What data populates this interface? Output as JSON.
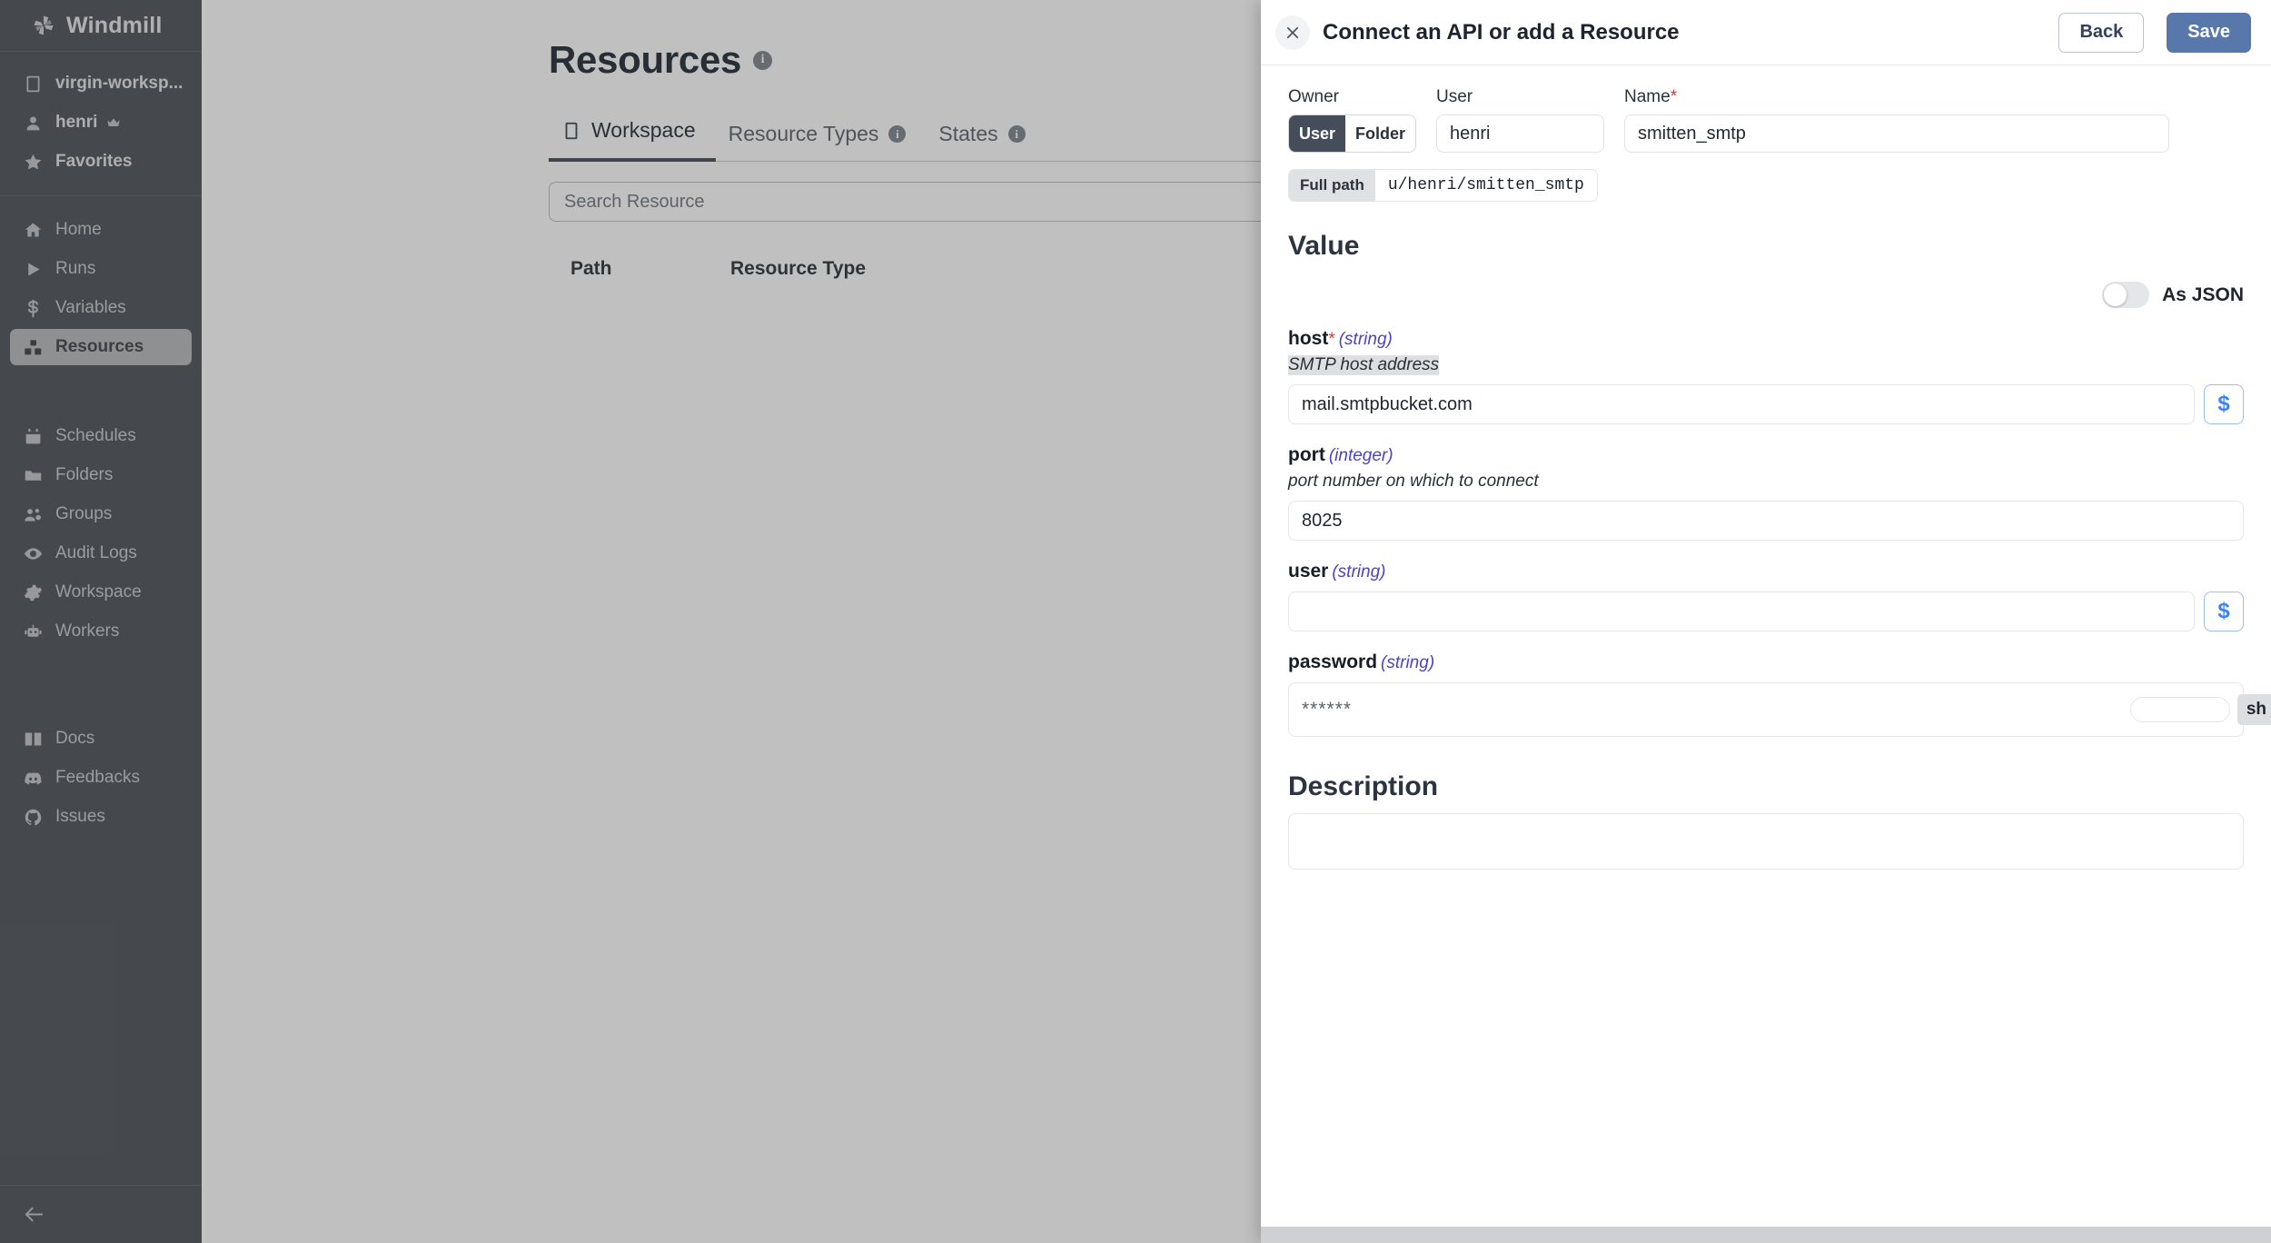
{
  "sidebar": {
    "brand": "Windmill",
    "top_items": [
      {
        "label": "virgin-worksp...",
        "icon": "building-icon",
        "name": "sidebar-item-workspace-switcher"
      },
      {
        "label": "henri",
        "icon": "user-icon",
        "name": "sidebar-item-user",
        "badge_icon": "crown-icon"
      },
      {
        "label": "Favorites",
        "icon": "star-icon",
        "name": "sidebar-item-favorites"
      }
    ],
    "main_items": [
      {
        "label": "Home",
        "icon": "home-icon",
        "name": "sidebar-item-home",
        "active": false
      },
      {
        "label": "Runs",
        "icon": "play-icon",
        "name": "sidebar-item-runs",
        "active": false
      },
      {
        "label": "Variables",
        "icon": "dollar-icon",
        "name": "sidebar-item-variables",
        "active": false
      },
      {
        "label": "Resources",
        "icon": "boxes-icon",
        "name": "sidebar-item-resources",
        "active": true
      }
    ],
    "admin_items": [
      {
        "label": "Schedules",
        "icon": "calendar-icon",
        "name": "sidebar-item-schedules"
      },
      {
        "label": "Folders",
        "icon": "folder-icon",
        "name": "sidebar-item-folders"
      },
      {
        "label": "Groups",
        "icon": "groups-icon",
        "name": "sidebar-item-groups"
      },
      {
        "label": "Audit Logs",
        "icon": "eye-icon",
        "name": "sidebar-item-audit-logs"
      },
      {
        "label": "Workspace",
        "icon": "gear-icon",
        "name": "sidebar-item-workspace"
      },
      {
        "label": "Workers",
        "icon": "robot-icon",
        "name": "sidebar-item-workers"
      }
    ],
    "help_items": [
      {
        "label": "Docs",
        "icon": "book-icon",
        "name": "sidebar-item-docs"
      },
      {
        "label": "Feedbacks",
        "icon": "discord-icon",
        "name": "sidebar-item-feedbacks"
      },
      {
        "label": "Issues",
        "icon": "github-icon",
        "name": "sidebar-item-issues"
      }
    ],
    "collapse_icon": "arrow-left-icon"
  },
  "main": {
    "page_title": "Resources",
    "page_title_info": "i",
    "tabs": [
      {
        "label": "Workspace",
        "icon": "building-icon",
        "active": true,
        "info": false
      },
      {
        "label": "Resource Types",
        "icon": "",
        "active": false,
        "info": true
      },
      {
        "label": "States",
        "icon": "",
        "active": false,
        "info": true
      }
    ],
    "search": {
      "placeholder": "Search Resource",
      "value": ""
    },
    "table": {
      "columns": [
        "Path",
        "Resource Type"
      ],
      "rows": []
    }
  },
  "drawer": {
    "title": "Connect an API or add a Resource",
    "close_icon": "close-icon",
    "back_label": "Back",
    "save_label": "Save",
    "owner": {
      "label": "Owner",
      "options": [
        "User",
        "Folder"
      ],
      "selected": "User"
    },
    "user": {
      "label": "User",
      "value": "henri"
    },
    "name": {
      "label": "Name",
      "required": "*",
      "value": "smitten_smtp"
    },
    "full_path": {
      "tag": "Full path",
      "value": "u/henri/smitten_smtp"
    },
    "value_section_title": "Value",
    "as_json": {
      "label": "As JSON",
      "enabled": false
    },
    "fields": [
      {
        "name": "host",
        "required": "*",
        "type": "(string)",
        "description": "SMTP host address",
        "description_highlighted": true,
        "value": "mail.smtpbucket.com",
        "has_dollar_button": true,
        "dollar_label": "$",
        "kind": "text"
      },
      {
        "name": "port",
        "required": "",
        "type": "(integer)",
        "description": "port number on which to connect",
        "description_highlighted": false,
        "value": "8025",
        "has_dollar_button": false,
        "dollar_label": "$",
        "kind": "text"
      },
      {
        "name": "user",
        "required": "",
        "type": "(string)",
        "description": "",
        "description_highlighted": false,
        "value": "",
        "has_dollar_button": true,
        "dollar_label": "$",
        "kind": "text"
      },
      {
        "name": "password",
        "required": "",
        "type": "(string)",
        "description": "",
        "description_highlighted": false,
        "value": "******",
        "has_dollar_button": false,
        "dollar_label": "$",
        "kind": "password",
        "tooltip": "sh"
      }
    ],
    "description_section_title": "Description",
    "description": {
      "value": "",
      "placeholder": ""
    }
  },
  "colors": {
    "sidebar_bg": "#4b4f55",
    "accent_save": "#5878ac",
    "type_purple": "#4b42c9",
    "required_red": "#d23b3b",
    "dollar_blue": "#3b82f6",
    "overlay": "rgba(60,60,60,0.32)"
  }
}
